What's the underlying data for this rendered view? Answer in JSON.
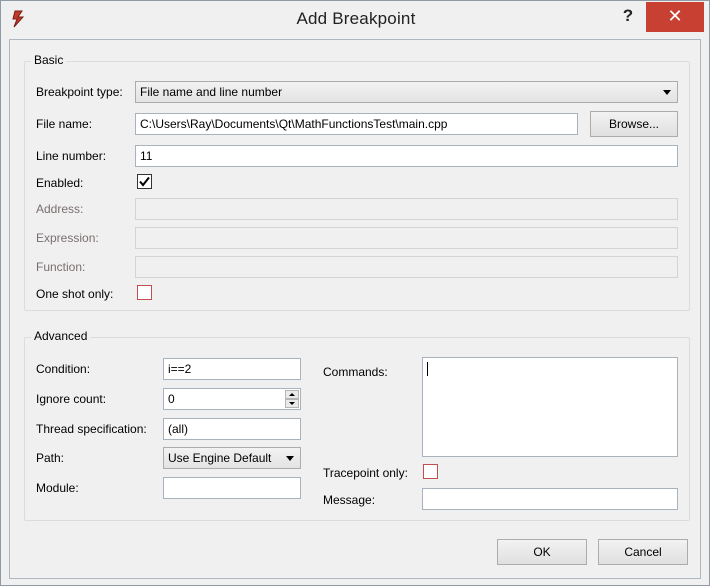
{
  "window": {
    "title": "Add Breakpoint",
    "help_label": "?",
    "close_label": "✕"
  },
  "basic": {
    "group_title": "Basic",
    "breakpoint_type_label": "Breakpoint type:",
    "breakpoint_type_value": "File name and line number",
    "file_name_label": "File name:",
    "file_name_value": "C:\\Users\\Ray\\Documents\\Qt\\MathFunctionsTest\\main.cpp",
    "browse_label": "Browse...",
    "line_number_label": "Line number:",
    "line_number_value": "11",
    "enabled_label": "Enabled:",
    "enabled_checked": true,
    "address_label": "Address:",
    "expression_label": "Expression:",
    "function_label": "Function:",
    "one_shot_label": "One shot only:",
    "one_shot_checked": false
  },
  "advanced": {
    "group_title": "Advanced",
    "condition_label": "Condition:",
    "condition_value": "i==2",
    "ignore_count_label": "Ignore count:",
    "ignore_count_value": "0",
    "thread_spec_label": "Thread specification:",
    "thread_spec_value": "(all)",
    "path_label": "Path:",
    "path_value": "Use Engine Default",
    "module_label": "Module:",
    "module_value": "",
    "commands_label": "Commands:",
    "commands_value": "",
    "tracepoint_label": "Tracepoint only:",
    "tracepoint_checked": false,
    "message_label": "Message:",
    "message_value": ""
  },
  "footer": {
    "ok_label": "OK",
    "cancel_label": "Cancel"
  },
  "colors": {
    "close_button": "#c84031",
    "app_icon": "#c0392b"
  },
  "icons": {
    "app": "qt-creator-bug-icon",
    "check": "check-mark-icon"
  }
}
